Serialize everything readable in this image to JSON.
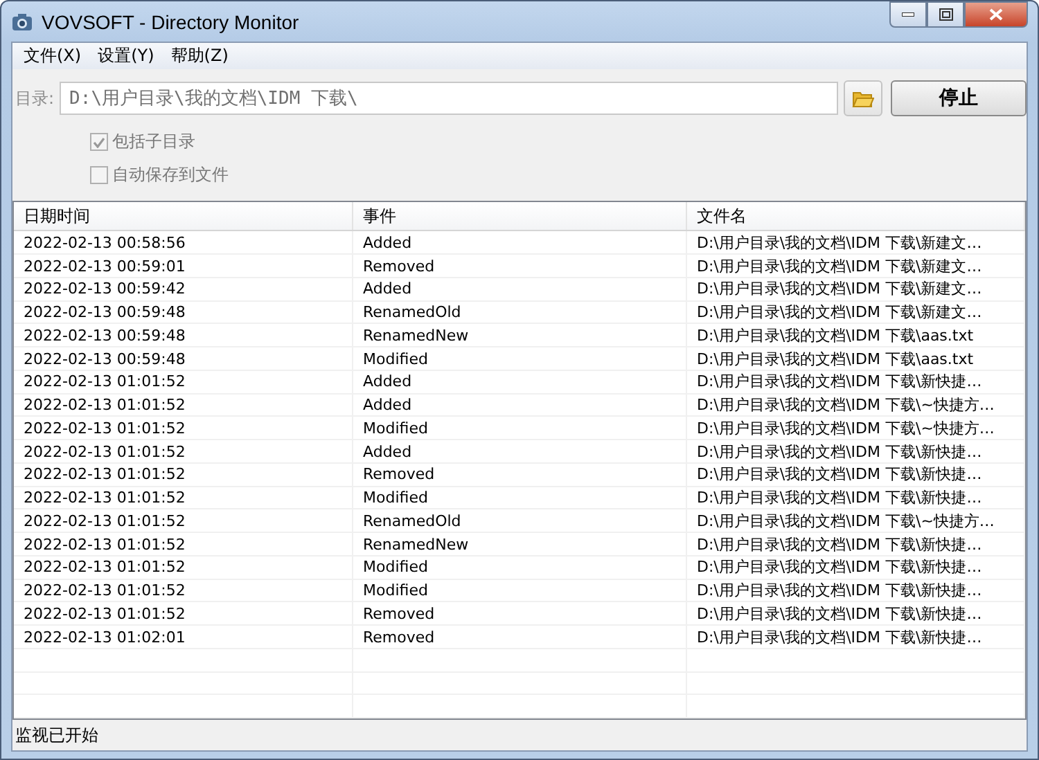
{
  "window": {
    "title": "VOVSOFT - Directory Monitor"
  },
  "menu": [
    "文件(X)",
    "设置(Y)",
    "帮助(Z)"
  ],
  "directory": {
    "label": "目录:",
    "value": "D:\\用户目录\\我的文档\\IDM 下载\\",
    "disabled": true
  },
  "stop_button": "停止",
  "options": [
    {
      "label": "包括子目录",
      "checked": true,
      "disabled": true
    },
    {
      "label": "自动保存到文件",
      "checked": false,
      "disabled": true
    }
  ],
  "table": {
    "columns": [
      "日期时间",
      "事件",
      "文件名"
    ],
    "rows": [
      [
        "2022-02-13 00:58:56",
        "Added",
        "D:\\用户目录\\我的文档\\IDM 下载\\新建文…"
      ],
      [
        "2022-02-13 00:59:01",
        "Removed",
        "D:\\用户目录\\我的文档\\IDM 下载\\新建文…"
      ],
      [
        "2022-02-13 00:59:42",
        "Added",
        "D:\\用户目录\\我的文档\\IDM 下载\\新建文…"
      ],
      [
        "2022-02-13 00:59:48",
        "RenamedOld",
        "D:\\用户目录\\我的文档\\IDM 下载\\新建文…"
      ],
      [
        "2022-02-13 00:59:48",
        "RenamedNew",
        "D:\\用户目录\\我的文档\\IDM 下载\\aas.txt"
      ],
      [
        "2022-02-13 00:59:48",
        "Modified",
        "D:\\用户目录\\我的文档\\IDM 下载\\aas.txt"
      ],
      [
        "2022-02-13 01:01:52",
        "Added",
        "D:\\用户目录\\我的文档\\IDM 下载\\新快捷…"
      ],
      [
        "2022-02-13 01:01:52",
        "Added",
        "D:\\用户目录\\我的文档\\IDM 下载\\~快捷方…"
      ],
      [
        "2022-02-13 01:01:52",
        "Modified",
        "D:\\用户目录\\我的文档\\IDM 下载\\~快捷方…"
      ],
      [
        "2022-02-13 01:01:52",
        "Added",
        "D:\\用户目录\\我的文档\\IDM 下载\\新快捷…"
      ],
      [
        "2022-02-13 01:01:52",
        "Removed",
        "D:\\用户目录\\我的文档\\IDM 下载\\新快捷…"
      ],
      [
        "2022-02-13 01:01:52",
        "Modified",
        "D:\\用户目录\\我的文档\\IDM 下载\\新快捷…"
      ],
      [
        "2022-02-13 01:01:52",
        "RenamedOld",
        "D:\\用户目录\\我的文档\\IDM 下载\\~快捷方…"
      ],
      [
        "2022-02-13 01:01:52",
        "RenamedNew",
        "D:\\用户目录\\我的文档\\IDM 下载\\新快捷…"
      ],
      [
        "2022-02-13 01:01:52",
        "Modified",
        "D:\\用户目录\\我的文档\\IDM 下载\\新快捷…"
      ],
      [
        "2022-02-13 01:01:52",
        "Modified",
        "D:\\用户目录\\我的文档\\IDM 下载\\新快捷…"
      ],
      [
        "2022-02-13 01:01:52",
        "Removed",
        "D:\\用户目录\\我的文档\\IDM 下载\\新快捷…"
      ],
      [
        "2022-02-13 01:02:01",
        "Removed",
        "D:\\用户目录\\我的文档\\IDM 下载\\新快捷…"
      ]
    ]
  },
  "status_bar": "监视已开始"
}
